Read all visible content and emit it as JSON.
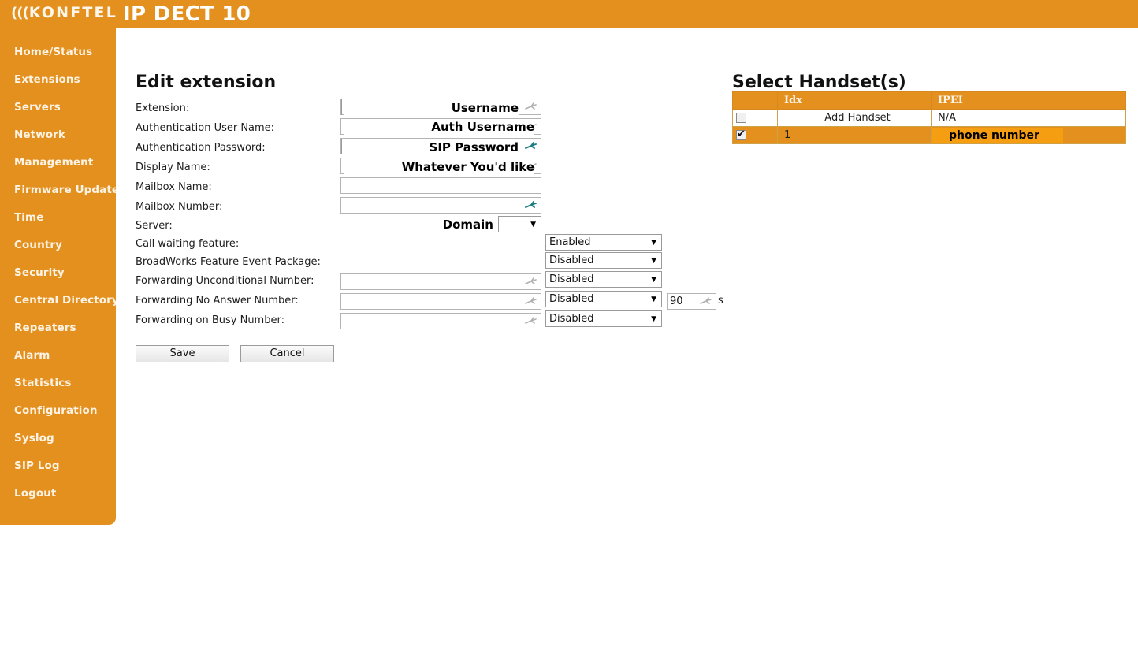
{
  "header": {
    "logo_waves": "(((",
    "logo_text": "KONFTEL",
    "product_title": "IP DECT 10",
    "brand_color": "#e3901f"
  },
  "sidebar": {
    "items": [
      {
        "label": "Home/Status"
      },
      {
        "label": "Extensions"
      },
      {
        "label": "Servers"
      },
      {
        "label": "Network"
      },
      {
        "label": "Management"
      },
      {
        "label": "Firmware Update"
      },
      {
        "label": "Time"
      },
      {
        "label": "Country"
      },
      {
        "label": "Security"
      },
      {
        "label": "Central Directory"
      },
      {
        "label": "Repeaters"
      },
      {
        "label": "Alarm"
      },
      {
        "label": "Statistics"
      },
      {
        "label": "Configuration"
      },
      {
        "label": "Syslog"
      },
      {
        "label": "SIP Log"
      },
      {
        "label": "Logout"
      }
    ]
  },
  "main": {
    "title": "Edit extension",
    "fields": {
      "extension": {
        "label": "Extension:",
        "value": "",
        "annotation": "Username"
      },
      "auth_user_name": {
        "label": "Authentication User Name:",
        "value": "",
        "annotation": "Auth Username"
      },
      "auth_password": {
        "label": "Authentication Password:",
        "value": "",
        "annotation": "SIP Password"
      },
      "display_name": {
        "label": "Display Name:",
        "value": "",
        "annotation": "Whatever You'd like"
      },
      "mailbox_name": {
        "label": "Mailbox Name:",
        "value": ""
      },
      "mailbox_number": {
        "label": "Mailbox Number:",
        "value": ""
      },
      "server": {
        "label": "Server:",
        "value": "",
        "annotation": "Domain"
      },
      "call_waiting": {
        "label": "Call waiting feature:",
        "value": "Enabled"
      },
      "broadworks": {
        "label": "BroadWorks Feature Event Package:",
        "value": "Disabled"
      },
      "fwd_unconditional": {
        "label": "Forwarding Unconditional Number:",
        "value": "",
        "state": "Disabled"
      },
      "fwd_no_answer": {
        "label": "Forwarding No Answer Number:",
        "value": "",
        "state": "Disabled",
        "timeout": "90",
        "timeout_unit": "s"
      },
      "fwd_busy": {
        "label": "Forwarding on Busy Number:",
        "value": "",
        "state": "Disabled"
      }
    },
    "buttons": {
      "save": "Save",
      "cancel": "Cancel"
    }
  },
  "handsets": {
    "title": "Select Handset(s)",
    "columns": [
      "",
      "Idx",
      "IPEI"
    ],
    "rows": [
      {
        "checked": false,
        "idx": "Add Handset",
        "ipei": "N/A",
        "selected": false,
        "idx_centered": true
      },
      {
        "checked": true,
        "idx": "1",
        "ipei": "phone number",
        "selected": true,
        "ipei_highlight": true
      }
    ]
  }
}
